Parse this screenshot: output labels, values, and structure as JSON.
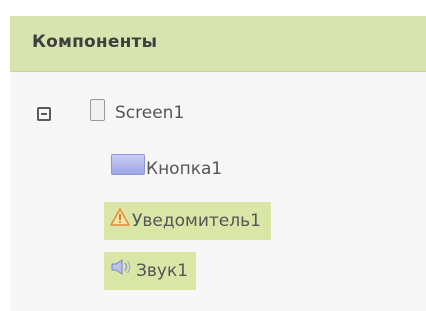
{
  "panel": {
    "title": "Компоненты"
  },
  "tree": {
    "root": {
      "label": "Screen1",
      "toggle_icon": "collapse-icon",
      "icon": "screen-icon",
      "children": [
        {
          "label": "Кнопка1",
          "icon": "button-component-icon"
        },
        {
          "label": "Уведомитель1",
          "icon": "warning-icon"
        },
        {
          "label": "Звук1",
          "icon": "speaker-icon"
        }
      ]
    }
  },
  "colors": {
    "header_bg": "#d7e4b0",
    "selection_bg": "#d9e6a6",
    "tree_bg": "#f7f7f7"
  }
}
